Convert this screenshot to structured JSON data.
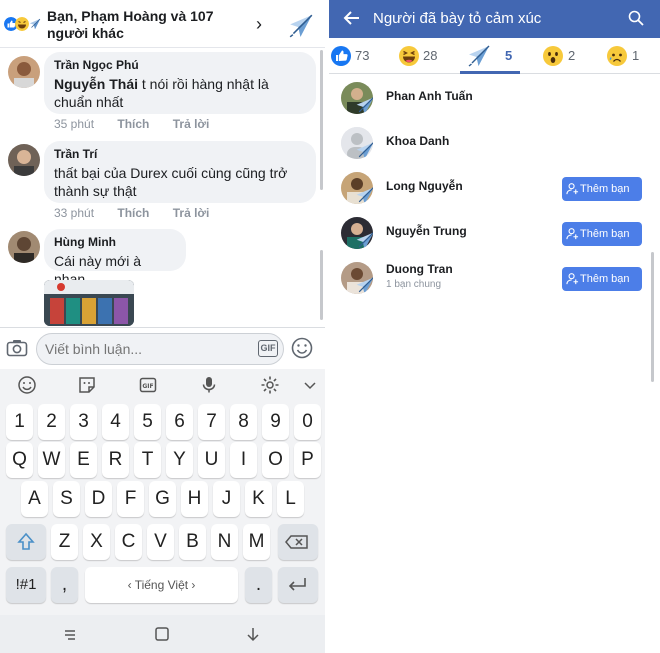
{
  "left": {
    "header": {
      "title": "Bạn, Phạm Hoàng và 107 người khác",
      "chevron_icon": "chevron-right-icon",
      "reaction_icon": "airplane-icon"
    },
    "comments": [
      {
        "author": "Trần Ngọc Phú",
        "tag": "Nguyễn Thái",
        "text": " t nói rồi hàng nhật là chuẩn nhất",
        "time": "35 phút",
        "like": "Thích",
        "reply": "Trả lời"
      },
      {
        "author": "Trần Trí",
        "tag": "",
        "text": "thất bại của Durex cuối cùng cũng trở thành sự thật",
        "time": "33 phút",
        "like": "Thích",
        "reply": "Trả lời"
      },
      {
        "author": "Hùng Minh",
        "tag": "",
        "text": "Cái này mới à nhan",
        "time": "",
        "like": "",
        "reply": ""
      }
    ],
    "composer": {
      "placeholder": "Viết bình luận...",
      "gif_label": "GIF"
    },
    "keyboard": {
      "row_numbers": [
        "1",
        "2",
        "3",
        "4",
        "5",
        "6",
        "7",
        "8",
        "9",
        "0"
      ],
      "row1": [
        "Q",
        "W",
        "E",
        "R",
        "T",
        "Y",
        "U",
        "I",
        "O",
        "P"
      ],
      "row2": [
        "A",
        "S",
        "D",
        "F",
        "G",
        "H",
        "J",
        "K",
        "L"
      ],
      "row3": [
        "Z",
        "X",
        "C",
        "V",
        "B",
        "N",
        "M"
      ],
      "symbols_key": "!#1",
      "comma_key": ",",
      "space_label": "‹ Tiếng Việt ›",
      "period_key": "."
    }
  },
  "right": {
    "header": {
      "title": "Người đã bày tỏ cảm xúc"
    },
    "tabs": [
      {
        "icon": "like-icon",
        "count": "73"
      },
      {
        "icon": "haha-icon",
        "count": "28"
      },
      {
        "icon": "airplane-icon",
        "count": "5"
      },
      {
        "icon": "wow-icon",
        "count": "2"
      },
      {
        "icon": "sad-icon",
        "count": "1"
      }
    ],
    "people": [
      {
        "name": "Phan Anh Tuấn",
        "sub": "",
        "button": ""
      },
      {
        "name": "Khoa Danh",
        "sub": "",
        "button": ""
      },
      {
        "name": "Long Nguyễn",
        "sub": "",
        "button": "Thêm bạn bè"
      },
      {
        "name": "Nguyễn Trung",
        "sub": "",
        "button": "Thêm bạn bè"
      },
      {
        "name": "Duong Tran",
        "sub": "1 bạn chung",
        "button": "Thêm bạn bè"
      }
    ]
  },
  "colors": {
    "facebook_blue": "#4267b2",
    "add_button": "#4c7ee8",
    "bubble_bg": "#f0f2f5"
  }
}
